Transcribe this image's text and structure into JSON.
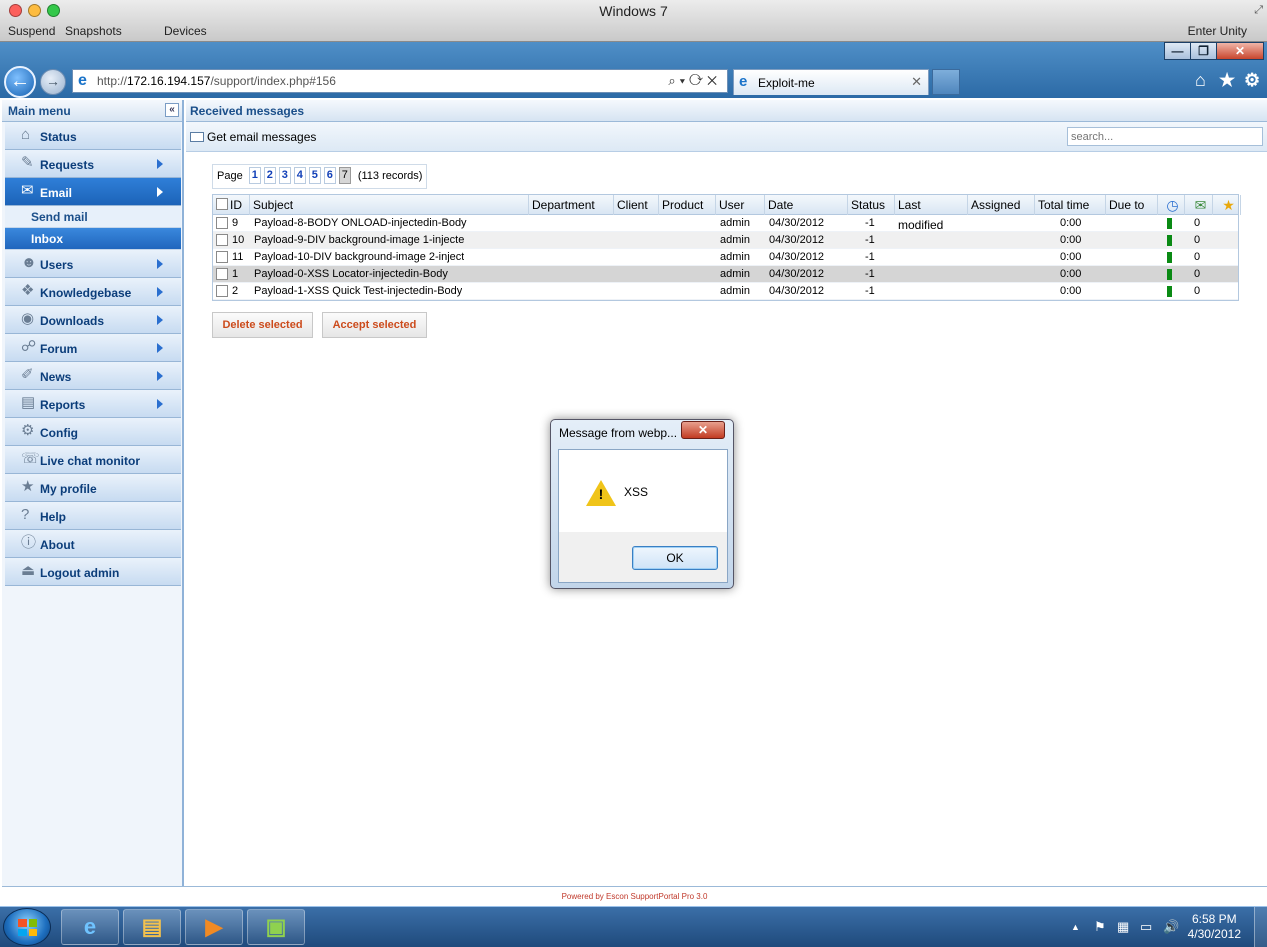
{
  "vm": {
    "title": "Windows 7",
    "menu": [
      "Suspend",
      "Snapshots",
      "Devices"
    ],
    "enter_unity": "Enter Unity",
    "colors": {
      "close": "#fc605c",
      "minimize": "#fdbc40",
      "zoom": "#34c84a"
    }
  },
  "browser": {
    "window_controls": {
      "minimize": "—",
      "restore": "❐",
      "close": "✕"
    },
    "back_icon": "←",
    "forward_icon": "→",
    "address": {
      "prefix": "http://",
      "host": "172.16.194.157",
      "path": "/support/index.php#156",
      "controls": "⌕▾⟳✕"
    },
    "tab": {
      "title": "Exploit-me",
      "close": "✕"
    },
    "icons": {
      "home": "⌂",
      "favorites": "★",
      "tools": "⚙"
    }
  },
  "sidebar": {
    "title": "Main menu",
    "collapse_icon": "«",
    "items": [
      {
        "label": "Status",
        "icon": "⌂",
        "arrow": false,
        "active": false
      },
      {
        "label": "Requests",
        "icon": "✎",
        "arrow": true,
        "active": false
      },
      {
        "label": "Email",
        "icon": "✉",
        "arrow": true,
        "active": true
      },
      {
        "label": "Users",
        "icon": "☻",
        "arrow": true,
        "active": false
      },
      {
        "label": "Knowledgebase",
        "icon": "❖",
        "arrow": true,
        "active": false
      },
      {
        "label": "Downloads",
        "icon": "◉",
        "arrow": true,
        "active": false
      },
      {
        "label": "Forum",
        "icon": "☍",
        "arrow": true,
        "active": false
      },
      {
        "label": "News",
        "icon": "✐",
        "arrow": true,
        "active": false
      },
      {
        "label": "Reports",
        "icon": "▤",
        "arrow": true,
        "active": false
      },
      {
        "label": "Config",
        "icon": "⚙",
        "arrow": false,
        "active": false
      },
      {
        "label": "Live chat monitor",
        "icon": "☏",
        "arrow": false,
        "active": false
      },
      {
        "label": "My profile",
        "icon": "★",
        "arrow": false,
        "active": false
      },
      {
        "label": "Help",
        "icon": "?",
        "arrow": false,
        "active": false
      },
      {
        "label": "About",
        "icon": "ⓘ",
        "arrow": false,
        "active": false
      },
      {
        "label": "Logout admin",
        "icon": "⏏",
        "arrow": false,
        "active": false
      }
    ],
    "email_sub": [
      "Send mail",
      "Inbox"
    ]
  },
  "content": {
    "title": "Received messages",
    "get_email": "Get email messages",
    "search_placeholder": "search...",
    "pager": {
      "label": "Page",
      "pages": [
        "1",
        "2",
        "3",
        "4",
        "5",
        "6",
        "7"
      ],
      "current": "7",
      "records": "(113 records)"
    },
    "columns": [
      "ID",
      "Subject",
      "Department",
      "Client",
      "Product",
      "User",
      "Date",
      "Status",
      "Last modified",
      "Assigned",
      "Total time",
      "Due to"
    ],
    "column_icons": {
      "time": "◷",
      "mail": "✉",
      "star": "★"
    },
    "rows": [
      {
        "id": "9",
        "subject": "Payload-8-BODY ONLOAD-injectedin-Body",
        "user": "admin",
        "date": "04/30/2012",
        "status": "-1",
        "total": "0:00",
        "count": "0"
      },
      {
        "id": "10",
        "subject": "Payload-9-DIV background-image 1-injecte",
        "user": "admin",
        "date": "04/30/2012",
        "status": "-1",
        "total": "0:00",
        "count": "0"
      },
      {
        "id": "11",
        "subject": "Payload-10-DIV background-image 2-inject",
        "user": "admin",
        "date": "04/30/2012",
        "status": "-1",
        "total": "0:00",
        "count": "0"
      },
      {
        "id": "1",
        "subject": "Payload-0-XSS Locator-injectedin-Body",
        "user": "admin",
        "date": "04/30/2012",
        "status": "-1",
        "total": "0:00",
        "count": "0"
      },
      {
        "id": "2",
        "subject": "Payload-1-XSS Quick Test-injectedin-Body",
        "user": "admin",
        "date": "04/30/2012",
        "status": "-1",
        "total": "0:00",
        "count": "0"
      }
    ],
    "buttons": {
      "delete": "Delete selected",
      "accept": "Accept selected"
    },
    "footer": "Powered by Escon SupportPortal Pro 3.0"
  },
  "dialog": {
    "title": "Message from webp...",
    "close": "✕",
    "message": "XSS",
    "warning_mark": "!",
    "ok": "OK"
  },
  "taskbar": {
    "apps": [
      {
        "name": "internet-explorer",
        "glyph": "e",
        "color": "#6fc3ff"
      },
      {
        "name": "file-explorer",
        "glyph": "▤",
        "color": "#f2c14e"
      },
      {
        "name": "media-player",
        "glyph": "▶",
        "color": "#f08a24"
      },
      {
        "name": "vmware-tools",
        "glyph": "▣",
        "color": "#8fd14f"
      }
    ],
    "tray_icons": [
      "▲",
      "⚑",
      "▦",
      "▭",
      "🔊"
    ],
    "clock_time": "6:58 PM",
    "clock_date": "4/30/2012"
  }
}
